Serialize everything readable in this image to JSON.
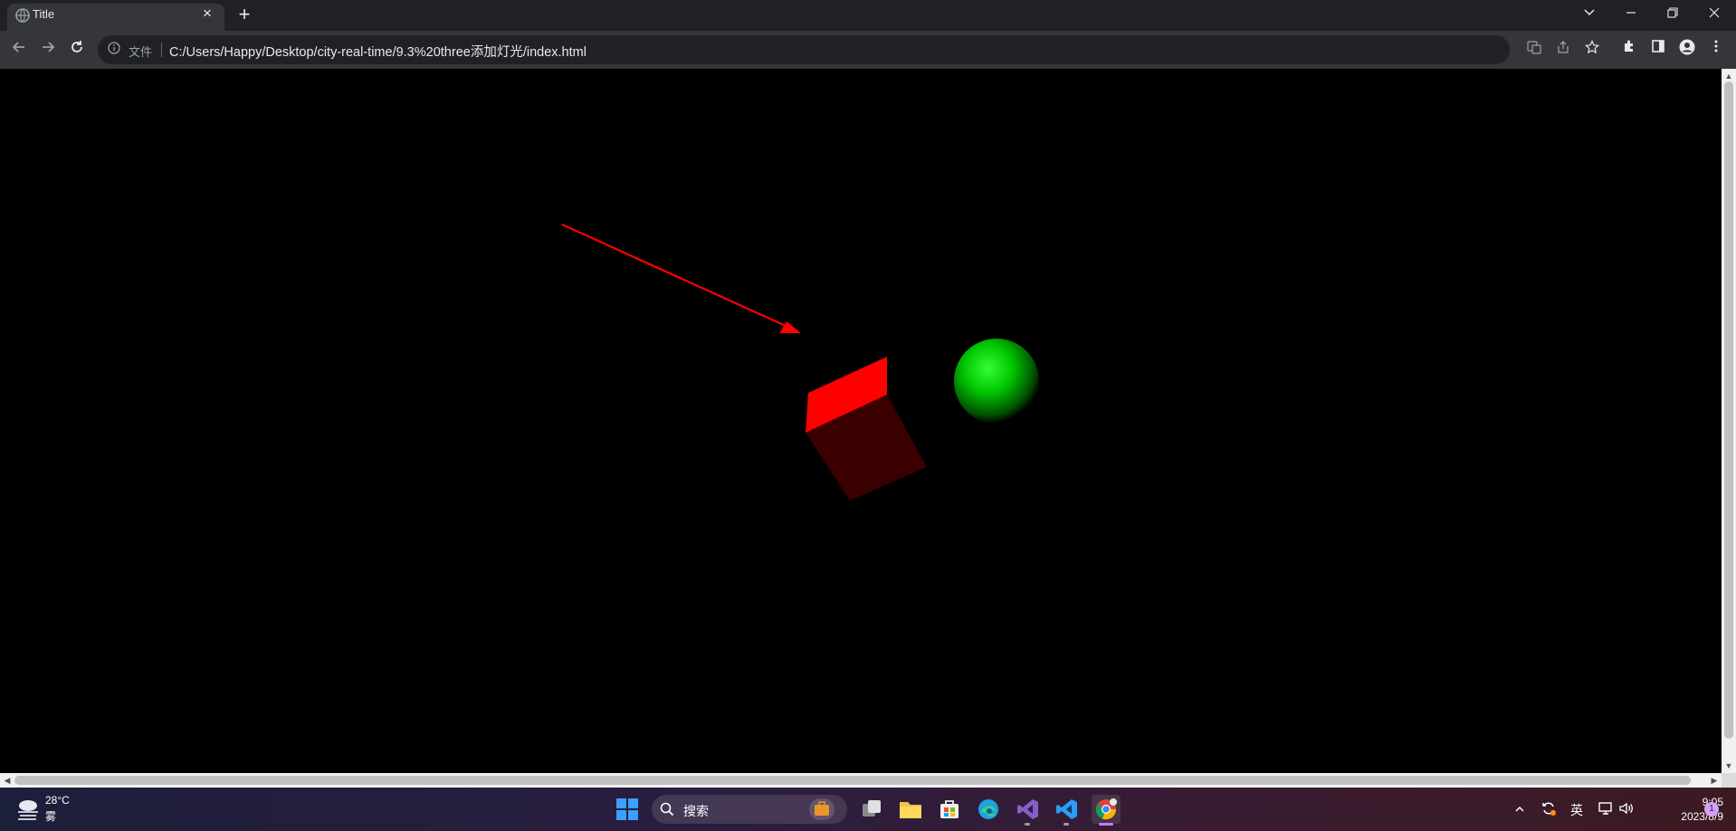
{
  "browser": {
    "tab_title": "Title",
    "tab_close": "×",
    "new_tab": "+",
    "file_label": "文件",
    "url": "C:/Users/Happy/Desktop/city-real-time/9.3%20three添加灯光/index.html"
  },
  "window_controls": {
    "dropdown": "⌄",
    "minimize": "—",
    "restore": "❐",
    "close": "✕"
  },
  "scene": {
    "background_color": "#000000",
    "arrow_color": "#ff0000",
    "cube_color": "#ff0000",
    "sphere_color": "#00cc00"
  },
  "taskbar": {
    "weather_temp": "28°C",
    "weather_desc": "雾",
    "search_label": "搜索",
    "language": "英",
    "time": "9:05",
    "date": "2023/8/9",
    "notification_count": "1"
  }
}
